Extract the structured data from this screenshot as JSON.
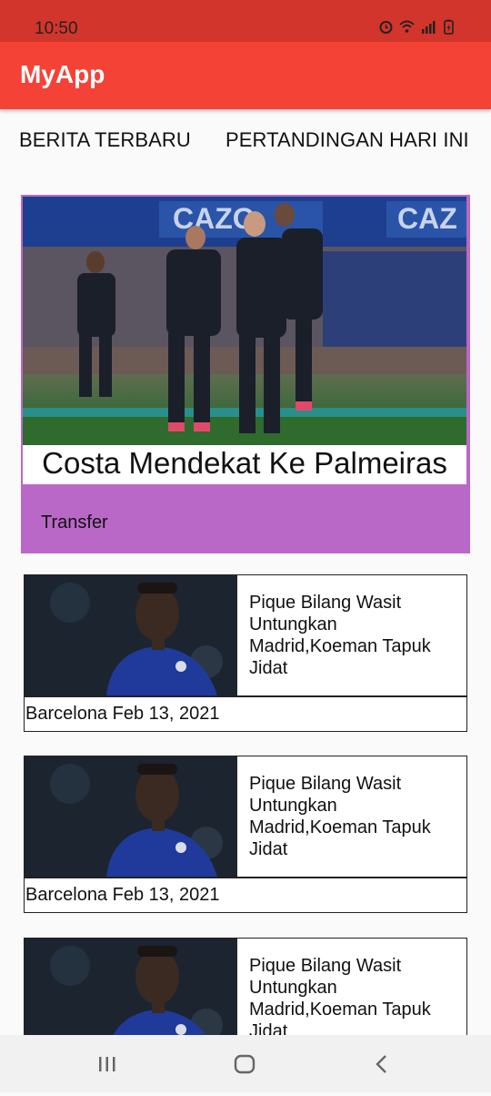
{
  "status_bar": {
    "time": "10:50",
    "icons": [
      "alarm-icon",
      "wifi-icon",
      "signal-icon",
      "battery-icon"
    ]
  },
  "app_bar": {
    "title": "MyApp"
  },
  "tabs": [
    {
      "label": "BERITA TERBARU"
    },
    {
      "label": "PERTANDINGAN HARI INI"
    }
  ],
  "featured": {
    "title": "Costa Mendekat Ke Palmeiras",
    "category": "Transfer",
    "image": "football-players-celebrating",
    "accent_color": "#ba68c8"
  },
  "news": [
    {
      "title": "Pique Bilang Wasit Untungkan Madrid,Koeman Tapuk Jidat",
      "meta": "Barcelona Feb 13, 2021",
      "image": "player-portrait"
    },
    {
      "title": "Pique Bilang Wasit Untungkan Madrid,Koeman Tapuk Jidat",
      "meta": "Barcelona Feb 13, 2021",
      "image": "player-portrait"
    },
    {
      "title": "Pique Bilang Wasit Untungkan Madrid,Koeman Tapuk Jidat",
      "meta": "",
      "image": "player-portrait"
    }
  ],
  "nav_bar": {
    "buttons": [
      "recents-icon",
      "home-icon",
      "back-icon"
    ]
  },
  "colors": {
    "primary": "#f44336",
    "primary_dark": "#d2352b"
  }
}
